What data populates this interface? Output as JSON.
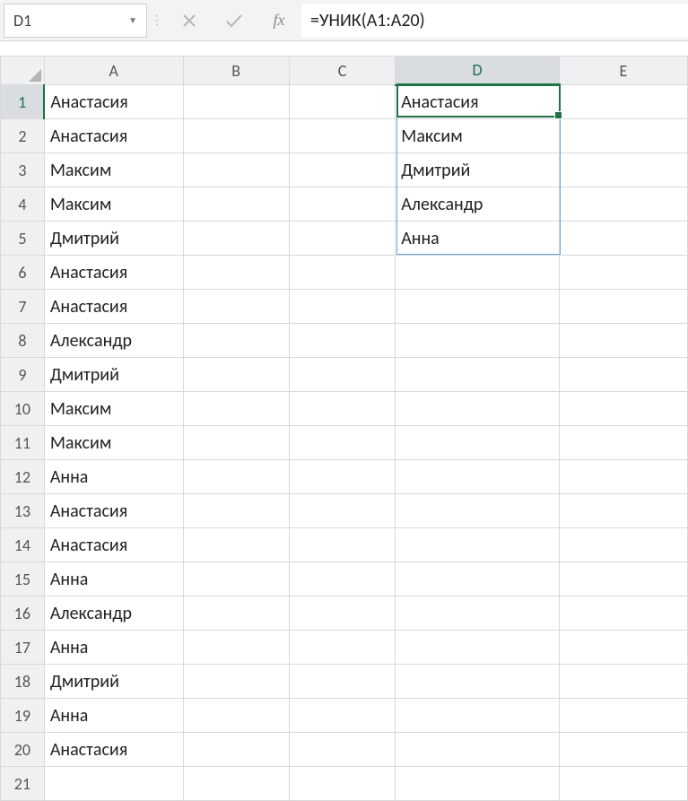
{
  "name_box": "D1",
  "formula": "=УНИК(A1:A20)",
  "fx_label": "fx",
  "columns": [
    "A",
    "B",
    "C",
    "D",
    "E"
  ],
  "rows": [
    "1",
    "2",
    "3",
    "4",
    "5",
    "6",
    "7",
    "8",
    "9",
    "10",
    "11",
    "12",
    "13",
    "14",
    "15",
    "16",
    "17",
    "18",
    "19",
    "20",
    "21"
  ],
  "active": {
    "col_index": 3,
    "row_index": 0
  },
  "spill": {
    "col_index": 3,
    "row_start": 0,
    "row_end": 4
  },
  "cells": {
    "0": {
      "0": "Анастасия",
      "3": "Анастасия"
    },
    "1": {
      "0": "Анастасия",
      "3": "Максим"
    },
    "2": {
      "0": "Максим",
      "3": "Дмитрий"
    },
    "3": {
      "0": "Максим",
      "3": "Александр"
    },
    "4": {
      "0": "Дмитрий",
      "3": "Анна"
    },
    "5": {
      "0": "Анастасия"
    },
    "6": {
      "0": "Анастасия"
    },
    "7": {
      "0": "Александр"
    },
    "8": {
      "0": "Дмитрий"
    },
    "9": {
      "0": "Максим"
    },
    "10": {
      "0": "Максим"
    },
    "11": {
      "0": "Анна"
    },
    "12": {
      "0": "Анастасия"
    },
    "13": {
      "0": "Анастасия"
    },
    "14": {
      "0": "Анна"
    },
    "15": {
      "0": "Александр"
    },
    "16": {
      "0": "Анна"
    },
    "17": {
      "0": "Дмитрий"
    },
    "18": {
      "0": "Анна"
    },
    "19": {
      "0": "Анастасия"
    }
  }
}
